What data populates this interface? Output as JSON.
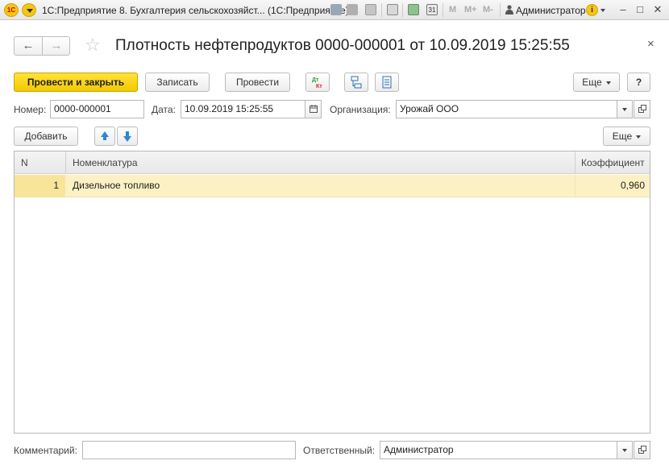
{
  "window": {
    "logo_text": "1С",
    "title": "1С:Предприятие 8. Бухгалтерия сельскохозяйст... (1С:Предприятие)",
    "toolbar_labels": [
      "M",
      "M+",
      "M-"
    ],
    "user": "Администратор",
    "info_glyph": "i"
  },
  "header": {
    "back_glyph": "←",
    "forward_glyph": "→",
    "star_glyph": "☆",
    "title": "Плотность нефтепродуктов 0000-000001 от 10.09.2019 15:25:55",
    "close_glyph": "×"
  },
  "command_bar": {
    "post_and_close": "Провести и закрыть",
    "save": "Записать",
    "post": "Провести",
    "more": "Еще",
    "help": "?"
  },
  "fields": {
    "number_label": "Номер:",
    "number_value": "0000-000001",
    "date_label": "Дата:",
    "date_value": "10.09.2019 15:25:55",
    "org_label": "Организация:",
    "org_value": "Урожай ООО"
  },
  "table_bar": {
    "add": "Добавить",
    "more": "Еще"
  },
  "table": {
    "columns": [
      "N",
      "Номенклатура",
      "Коэффициент"
    ],
    "rows": [
      {
        "n": "1",
        "item": "Дизельное топливо",
        "coef": "0,960"
      }
    ]
  },
  "footer": {
    "comment_label": "Комментарий:",
    "comment_value": "",
    "responsible_label": "Ответственный:",
    "responsible_value": "Администратор"
  }
}
